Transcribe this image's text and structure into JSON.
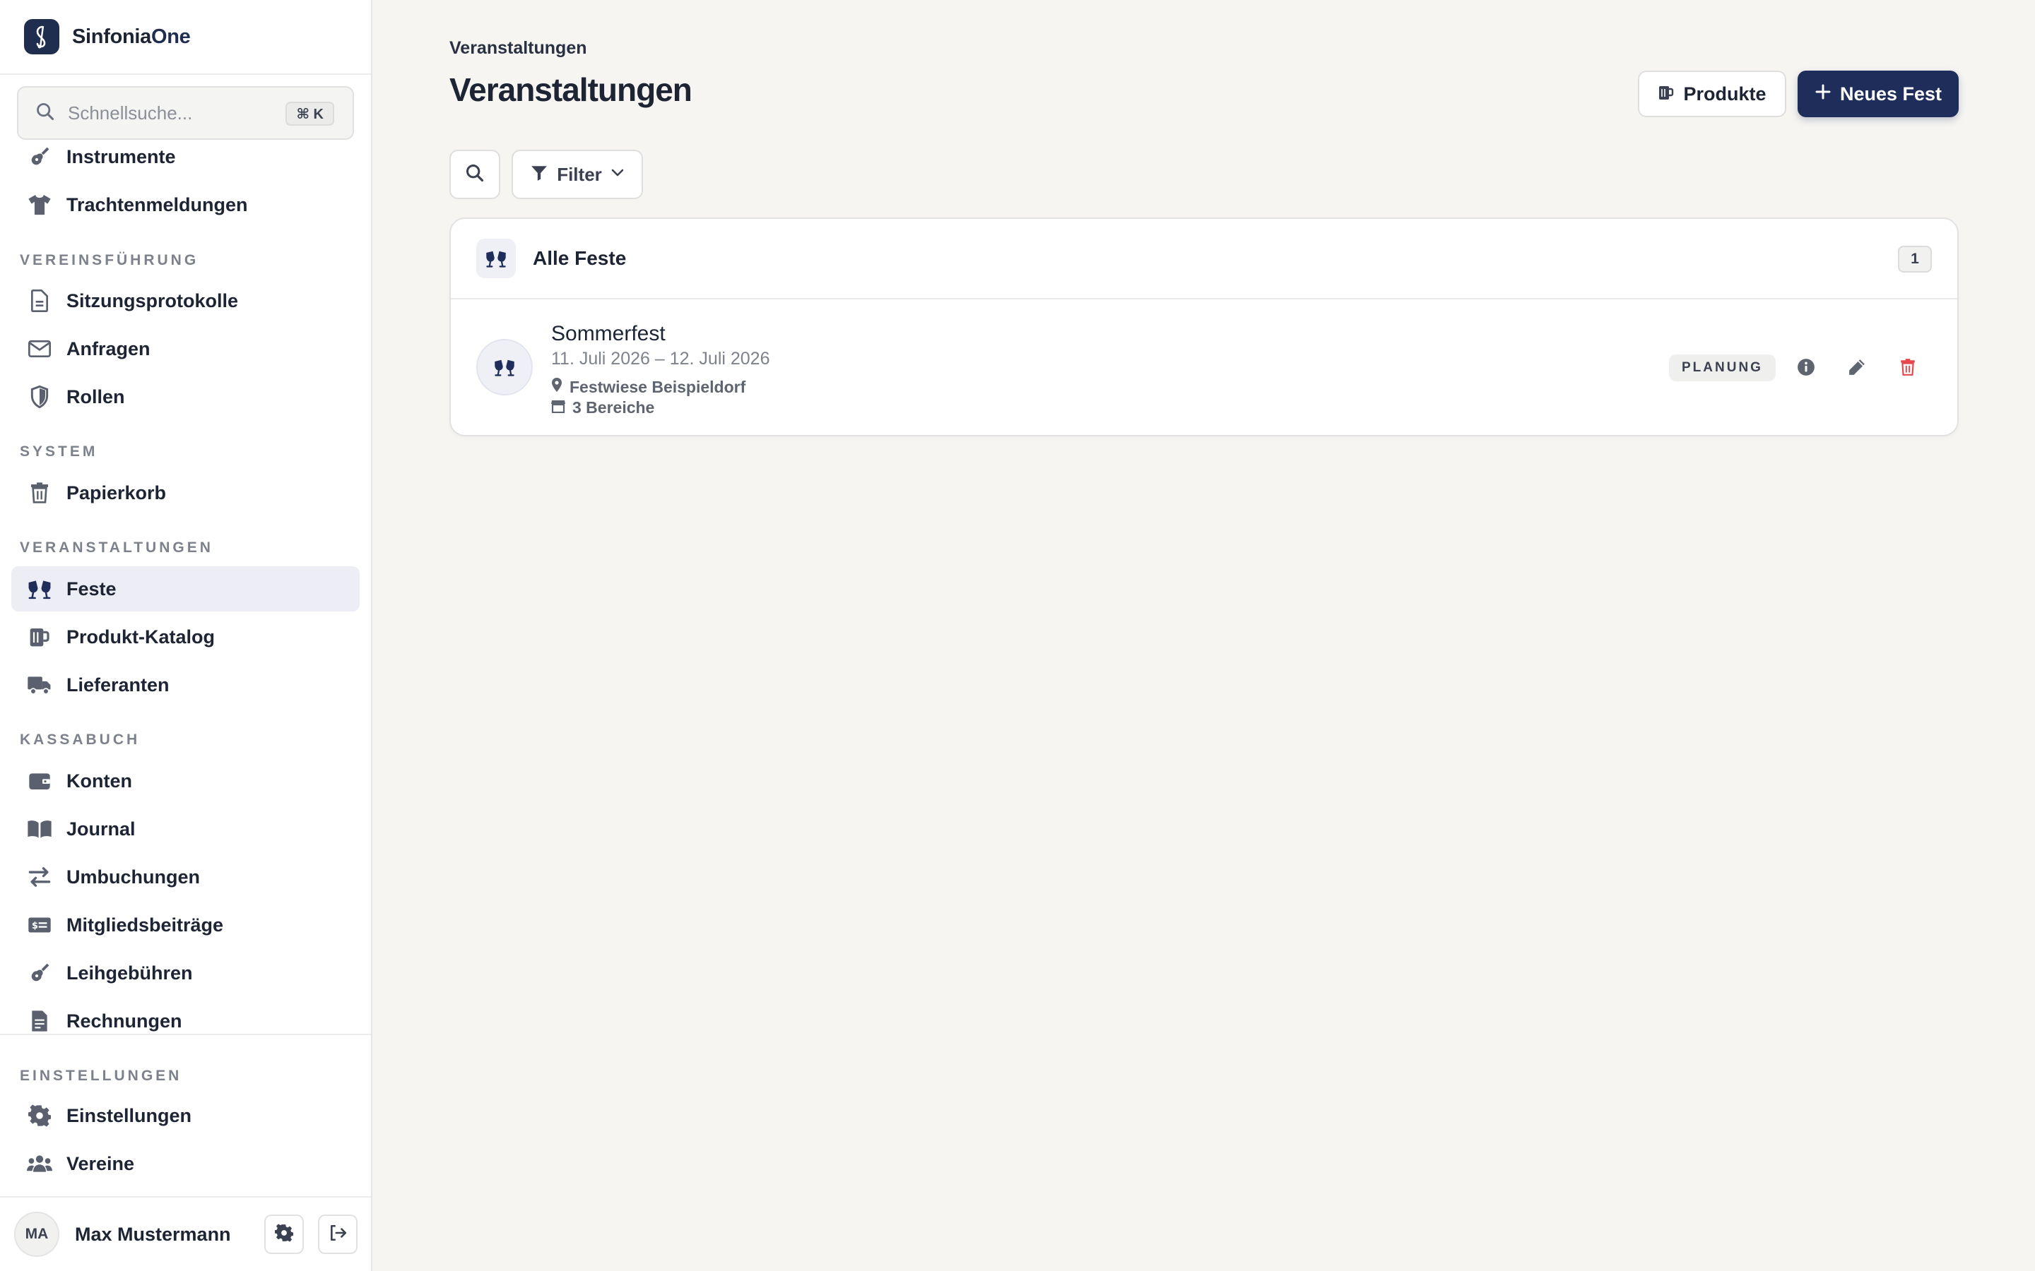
{
  "brand": {
    "name_part1": "Sinfonia",
    "name_part2": "One"
  },
  "search": {
    "placeholder": "Schnellsuche...",
    "shortcut": "⌘ K"
  },
  "sidebar": {
    "items_top": [
      {
        "label": "Instrumente",
        "icon": "guitar-icon"
      },
      {
        "label": "Trachtenmeldungen",
        "icon": "shirt-icon"
      }
    ],
    "sections": [
      {
        "title": "VEREINSFÜHRUNG",
        "items": [
          {
            "label": "Sitzungsprotokolle",
            "icon": "document-icon"
          },
          {
            "label": "Anfragen",
            "icon": "envelope-icon"
          },
          {
            "label": "Rollen",
            "icon": "shield-icon"
          }
        ]
      },
      {
        "title": "SYSTEM",
        "items": [
          {
            "label": "Papierkorb",
            "icon": "trash-icon"
          }
        ]
      },
      {
        "title": "VERANSTALTUNGEN",
        "items": [
          {
            "label": "Feste",
            "icon": "cheers-icon",
            "active": true
          },
          {
            "label": "Produkt-Katalog",
            "icon": "beer-mug-icon"
          },
          {
            "label": "Lieferanten",
            "icon": "truck-icon"
          }
        ]
      },
      {
        "title": "KASSABUCH",
        "items": [
          {
            "label": "Konten",
            "icon": "wallet-icon"
          },
          {
            "label": "Journal",
            "icon": "book-icon"
          },
          {
            "label": "Umbuchungen",
            "icon": "transfer-icon"
          },
          {
            "label": "Mitgliedsbeiträge",
            "icon": "money-card-icon"
          },
          {
            "label": "Leihgebühren",
            "icon": "guitar-icon"
          },
          {
            "label": "Rechnungen",
            "icon": "invoice-icon"
          }
        ]
      },
      {
        "title": "EINSTELLUNGEN",
        "items": [
          {
            "label": "Einstellungen",
            "icon": "gear-icon"
          },
          {
            "label": "Vereine",
            "icon": "users-icon"
          }
        ]
      }
    ]
  },
  "user": {
    "initials": "MA",
    "name": "Max Mustermann"
  },
  "main": {
    "breadcrumb": "Veranstaltungen",
    "title": "Veranstaltungen",
    "buttons": {
      "products": "Produkte",
      "new_fest": "Neues Fest"
    },
    "filter_label": "Filter",
    "group": {
      "title": "Alle Feste",
      "count": "1",
      "events": [
        {
          "name": "Sommerfest",
          "dates": "11. Juli 2026 – 12. Juli 2026",
          "location": "Festwiese Beispieldorf",
          "areas": "3 Bereiche",
          "status": "PLANUNG"
        }
      ]
    }
  },
  "colors": {
    "primary": "#1f2d5a",
    "danger": "#e5484d",
    "background": "#f6f5f2"
  }
}
